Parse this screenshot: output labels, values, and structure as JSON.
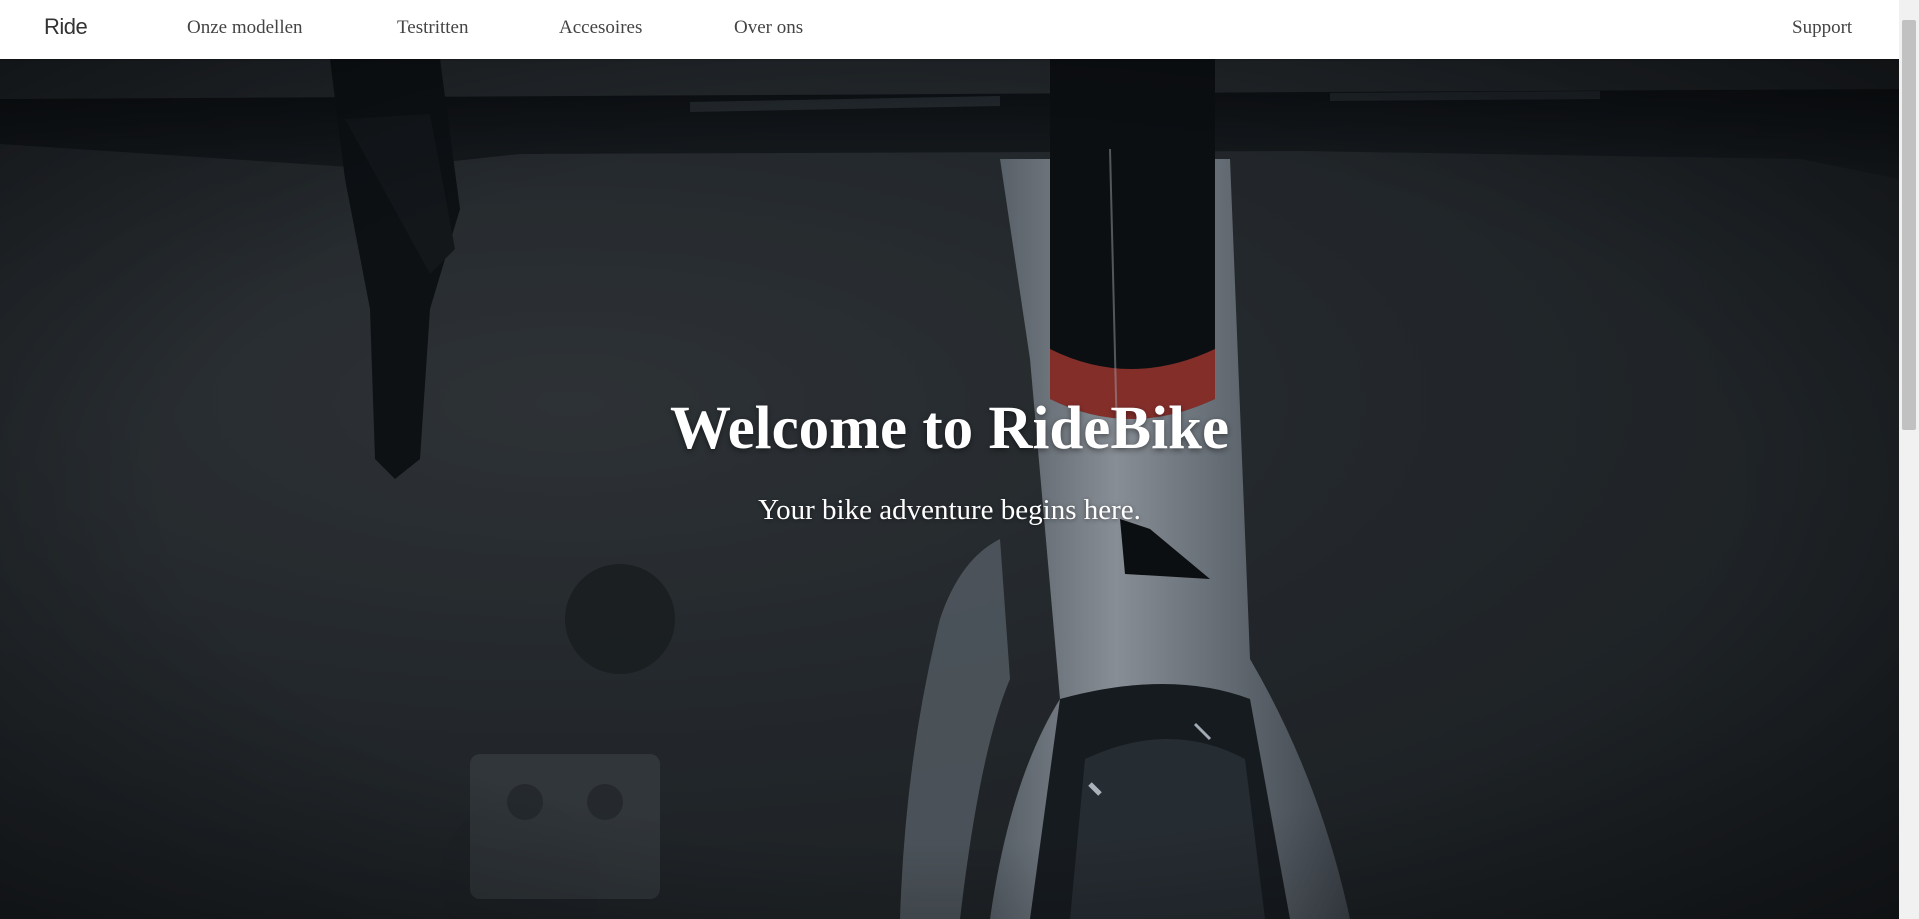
{
  "nav": {
    "logo": "Ride",
    "links": [
      "Onze modellen",
      "Testritten",
      "Accesoires",
      "Over ons"
    ],
    "support": "Support"
  },
  "hero": {
    "title": "Welcome to RideBike",
    "subtitle": "Your bike adventure begins here.",
    "background_image": "dark close-up of a road bike handlebar and frame"
  },
  "colors": {
    "nav_background": "#ffffff",
    "nav_text": "#444444",
    "hero_text": "#ffffff",
    "hero_background": "#2c3135"
  }
}
